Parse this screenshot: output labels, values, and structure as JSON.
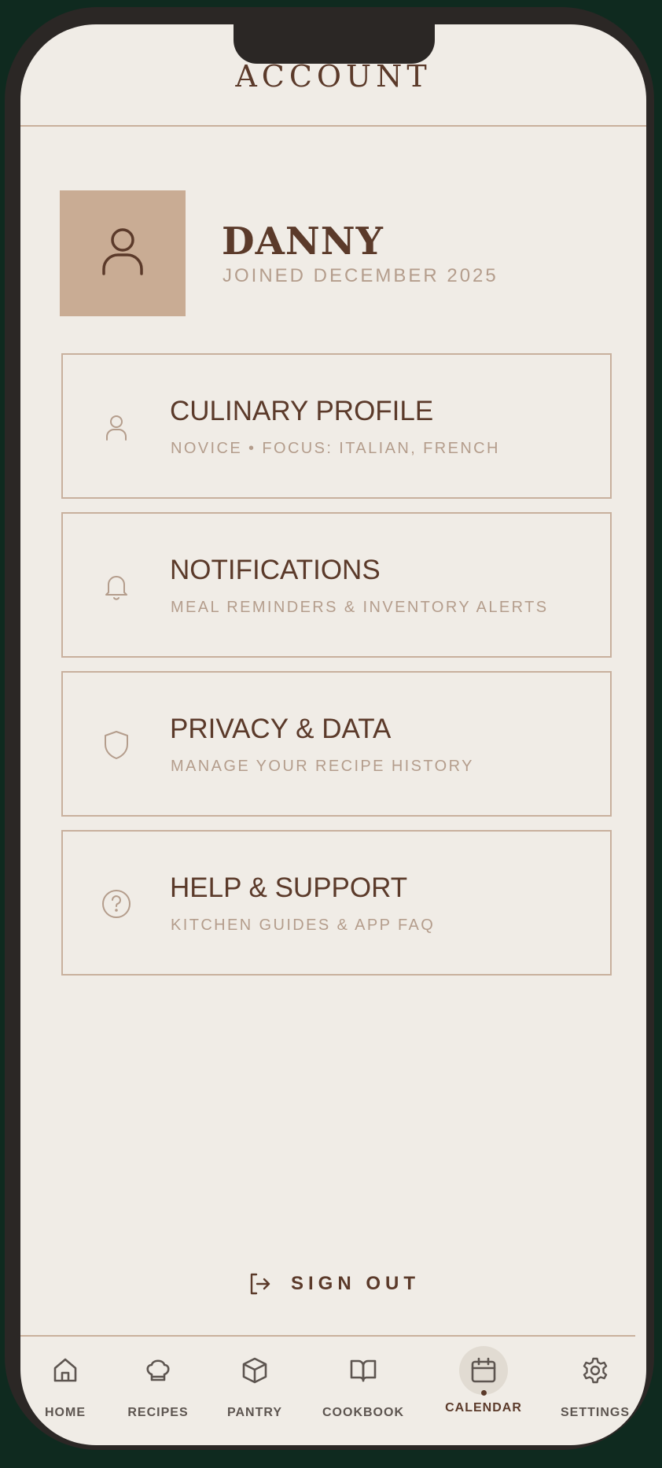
{
  "header": {
    "title": "ACCOUNT"
  },
  "profile": {
    "name": "DANNY",
    "joined": "JOINED DECEMBER 2025"
  },
  "cards": [
    {
      "icon": "user-icon",
      "title": "CULINARY PROFILE",
      "desc": "NOVICE • FOCUS: ITALIAN, FRENCH"
    },
    {
      "icon": "bell-icon",
      "title": "NOTIFICATIONS",
      "desc": "MEAL REMINDERS & INVENTORY ALERTS"
    },
    {
      "icon": "shield-icon",
      "title": "PRIVACY & DATA",
      "desc": "MANAGE YOUR RECIPE HISTORY"
    },
    {
      "icon": "help-circle-icon",
      "title": "HELP & SUPPORT",
      "desc": "KITCHEN GUIDES & APP FAQ"
    }
  ],
  "signout": {
    "label": "SIGN OUT",
    "icon": "log-out-icon"
  },
  "nav": {
    "active": "CALENDAR",
    "items": [
      {
        "label": "HOME",
        "icon": "home-icon"
      },
      {
        "label": "RECIPES",
        "icon": "chef-hat-icon"
      },
      {
        "label": "PANTRY",
        "icon": "box-icon"
      },
      {
        "label": "COOKBOOK",
        "icon": "book-open-icon"
      },
      {
        "label": "CALENDAR",
        "icon": "calendar-icon"
      },
      {
        "label": "SETTINGS",
        "icon": "gear-icon"
      }
    ]
  },
  "colors": {
    "background": "#f0ece6",
    "accent": "#5b3a2a",
    "muted": "#b49d8c",
    "avatar": "#c9ac94",
    "frame": "#2b2725"
  }
}
